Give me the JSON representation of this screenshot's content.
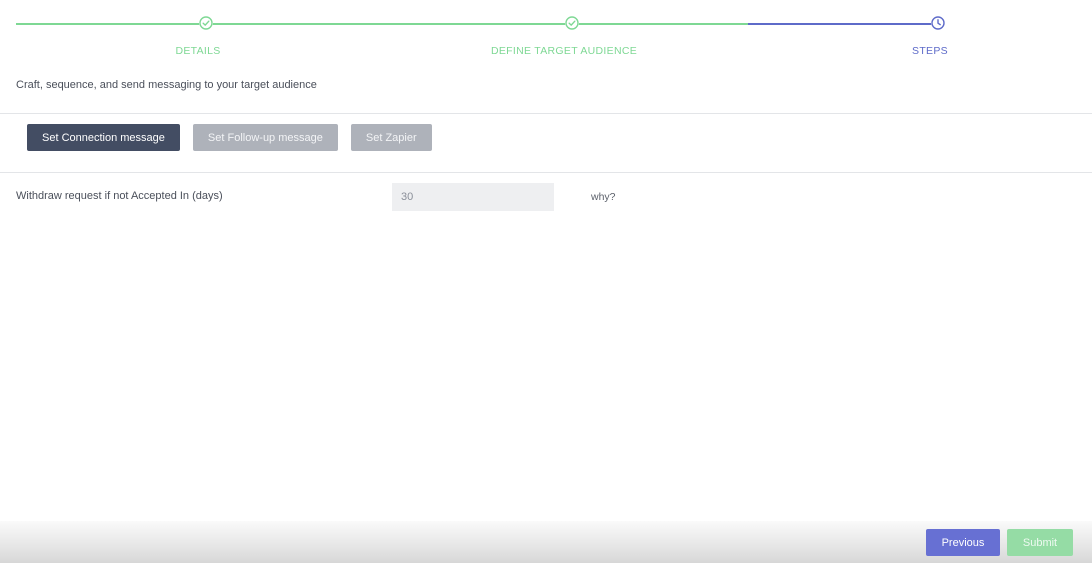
{
  "stepper": {
    "steps": [
      {
        "label": "DETAILS",
        "status": "done",
        "icon": "check-circle-icon"
      },
      {
        "label": "DEFINE TARGET AUDIENCE",
        "status": "done",
        "icon": "check-circle-icon"
      },
      {
        "label": "STEPS",
        "status": "active",
        "icon": "clock-icon"
      }
    ]
  },
  "intro_text": "Craft, sequence, and send messaging to your target audience",
  "message_tabs": {
    "connection": "Set Connection message",
    "follow_up": "Set Follow-up message",
    "zapier": "Set Zapier"
  },
  "withdraw": {
    "label": "Withdraw request if not Accepted In (days)",
    "value": "30",
    "help_link": "why?"
  },
  "footer": {
    "previous_label": "Previous",
    "submit_label": "Submit"
  },
  "colors": {
    "done": "#7ed894",
    "active": "#5e6bc9",
    "primary_button": "#434d63",
    "secondary_button": "#aeb2ba",
    "previous_button": "#6770d3",
    "submit_button": "#95dca5"
  }
}
